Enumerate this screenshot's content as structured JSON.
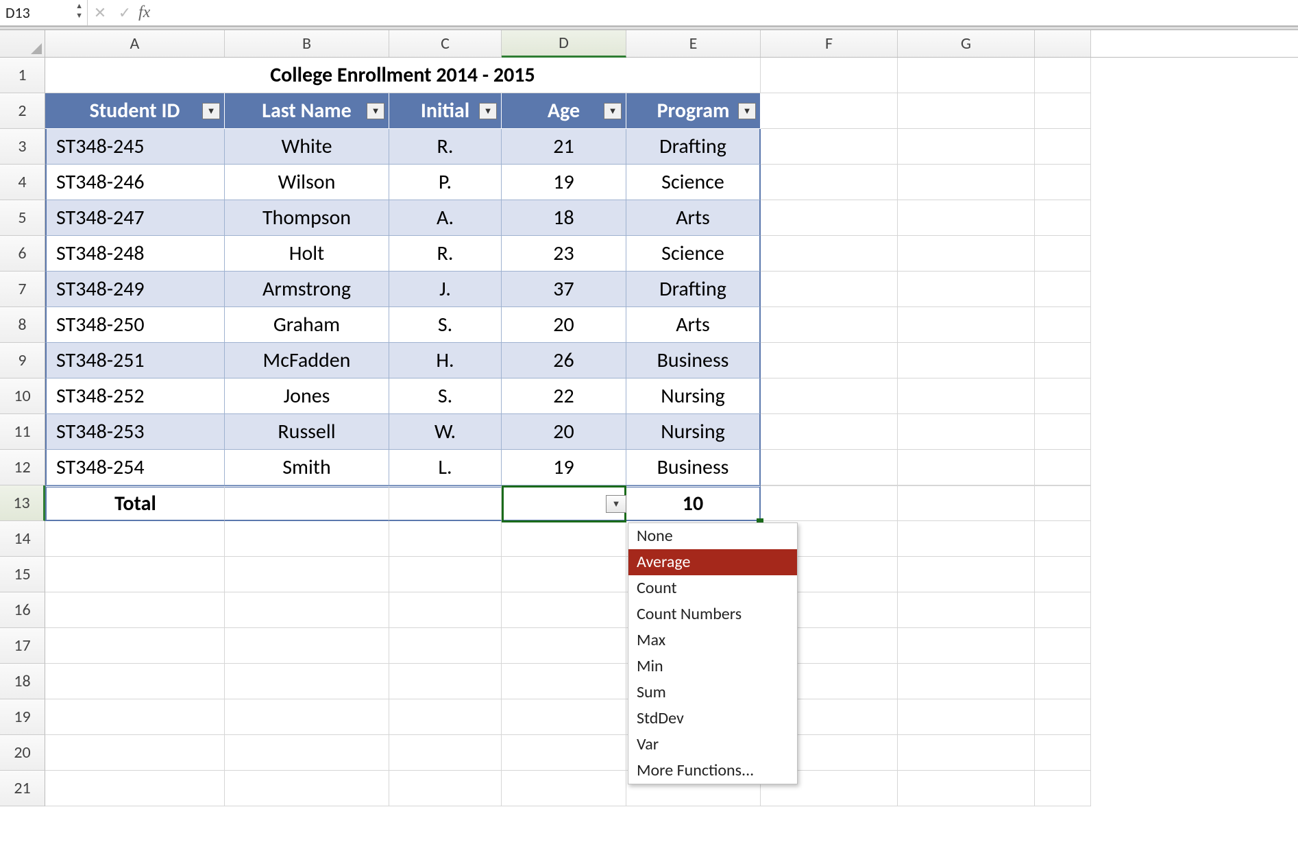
{
  "formula_bar": {
    "cell_ref": "D13",
    "formula": ""
  },
  "columns": [
    "A",
    "B",
    "C",
    "D",
    "E",
    "F",
    "G"
  ],
  "active_column": "D",
  "active_row": "13",
  "title": "College Enrollment 2014 - 2015",
  "table": {
    "headers": [
      "Student ID",
      "Last Name",
      "Initial",
      "Age",
      "Program"
    ],
    "rows": [
      {
        "id": "ST348-245",
        "last": "White",
        "init": "R.",
        "age": "21",
        "prog": "Drafting"
      },
      {
        "id": "ST348-246",
        "last": "Wilson",
        "init": "P.",
        "age": "19",
        "prog": "Science"
      },
      {
        "id": "ST348-247",
        "last": "Thompson",
        "init": "A.",
        "age": "18",
        "prog": "Arts"
      },
      {
        "id": "ST348-248",
        "last": "Holt",
        "init": "R.",
        "age": "23",
        "prog": "Science"
      },
      {
        "id": "ST348-249",
        "last": "Armstrong",
        "init": "J.",
        "age": "37",
        "prog": "Drafting"
      },
      {
        "id": "ST348-250",
        "last": "Graham",
        "init": "S.",
        "age": "20",
        "prog": "Arts"
      },
      {
        "id": "ST348-251",
        "last": "McFadden",
        "init": "H.",
        "age": "26",
        "prog": "Business"
      },
      {
        "id": "ST348-252",
        "last": "Jones",
        "init": "S.",
        "age": "22",
        "prog": "Nursing"
      },
      {
        "id": "ST348-253",
        "last": "Russell",
        "init": "W.",
        "age": "20",
        "prog": "Nursing"
      },
      {
        "id": "ST348-254",
        "last": "Smith",
        "init": "L.",
        "age": "19",
        "prog": "Business"
      }
    ],
    "total": {
      "label": "Total",
      "value": "10"
    }
  },
  "menu": {
    "items": [
      "None",
      "Average",
      "Count",
      "Count Numbers",
      "Max",
      "Min",
      "Sum",
      "StdDev",
      "Var",
      "More Functions..."
    ],
    "selected_index": 1
  },
  "row_numbers": [
    "1",
    "2",
    "3",
    "4",
    "5",
    "6",
    "7",
    "8",
    "9",
    "10",
    "11",
    "12",
    "13",
    "14",
    "15",
    "16",
    "17",
    "18",
    "19",
    "20",
    "21"
  ]
}
